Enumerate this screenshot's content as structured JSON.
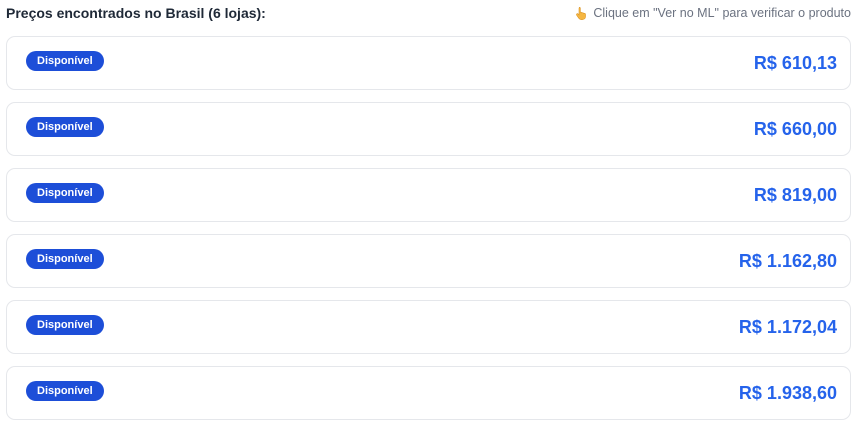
{
  "header": {
    "title": "Preços encontrados no Brasil (6 lojas):",
    "hint_icon": "pointing-hand-icon",
    "hint": "Clique em \"Ver no ML\" para verificar o produto"
  },
  "colors": {
    "badge_bg": "#1d4ed8",
    "price": "#2563eb",
    "card_border": "#e5e7eb"
  },
  "offers": [
    {
      "status": "Disponível",
      "price": "R$ 610,13"
    },
    {
      "status": "Disponível",
      "price": "R$ 660,00"
    },
    {
      "status": "Disponível",
      "price": "R$ 819,00"
    },
    {
      "status": "Disponível",
      "price": "R$ 1.162,80"
    },
    {
      "status": "Disponível",
      "price": "R$ 1.172,04"
    },
    {
      "status": "Disponível",
      "price": "R$ 1.938,60"
    }
  ]
}
